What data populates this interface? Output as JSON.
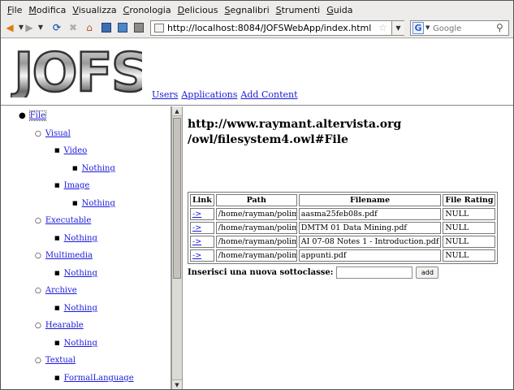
{
  "menubar": {
    "items": [
      {
        "first": "F",
        "rest": "ile"
      },
      {
        "first": "M",
        "rest": "odifica"
      },
      {
        "first": "V",
        "rest": "isualizza"
      },
      {
        "first": "C",
        "rest": "ronologia"
      },
      {
        "first": "D",
        "rest": "elicious"
      },
      {
        "first": "S",
        "rest": "egnalibri"
      },
      {
        "first": "S",
        "rest": "trumenti"
      },
      {
        "first": "G",
        "rest": "uida"
      }
    ]
  },
  "toolbar": {
    "url": "http://localhost:8084/JOFSWebApp/index.html",
    "search_engine_icon": "G",
    "search_placeholder": "Google",
    "icons": [
      "back-icon",
      "forward-icon",
      "reload-icon",
      "stop-icon",
      "home-icon",
      "star-icon",
      "search-go-icon"
    ]
  },
  "header": {
    "logo_text": "JOFS",
    "links": [
      "Users",
      "Applications",
      "Add Content"
    ]
  },
  "tree": {
    "items": [
      {
        "label": "File",
        "level": 0
      },
      {
        "label": "Visual",
        "level": 1
      },
      {
        "label": "Video",
        "level": 2
      },
      {
        "label": "Nothing",
        "level": 3
      },
      {
        "label": "Image",
        "level": 2
      },
      {
        "label": "Nothing",
        "level": 3
      },
      {
        "label": "Executable",
        "level": 1
      },
      {
        "label": "Nothing",
        "level": 2
      },
      {
        "label": "Multimedia",
        "level": 1
      },
      {
        "label": "Nothing",
        "level": 2
      },
      {
        "label": "Archive",
        "level": 1
      },
      {
        "label": "Nothing",
        "level": 2
      },
      {
        "label": "Hearable",
        "level": 1
      },
      {
        "label": "Nothing",
        "level": 2
      },
      {
        "label": "Textual",
        "level": 1
      },
      {
        "label": "FormalLanguage",
        "level": 2
      }
    ]
  },
  "main": {
    "heading_line1": "http://www.raymant.altervista.org",
    "heading_line2": "/owl/filesystem4.owl#File",
    "table": {
      "headers": [
        "Link",
        "Path",
        "Filename",
        "File Rating"
      ],
      "rows": [
        {
          "link": "->",
          "path": "/home/rayman/polimi/",
          "filename": "aasma25feb08s.pdf",
          "rating": "NULL"
        },
        {
          "link": "->",
          "path": "/home/rayman/polimi/",
          "filename": "DMTM 01 Data Mining.pdf",
          "rating": "NULL"
        },
        {
          "link": "->",
          "path": "/home/rayman/polimi/",
          "filename": "AI 07-08 Notes 1 - Introduction.pdf",
          "rating": "NULL"
        },
        {
          "link": "->",
          "path": "/home/rayman/polimi/",
          "filename": "appunti.pdf",
          "rating": "NULL"
        }
      ]
    },
    "form": {
      "label": "Inserisci una nuova sottoclasse:",
      "input_value": "",
      "button_label": "add"
    }
  }
}
